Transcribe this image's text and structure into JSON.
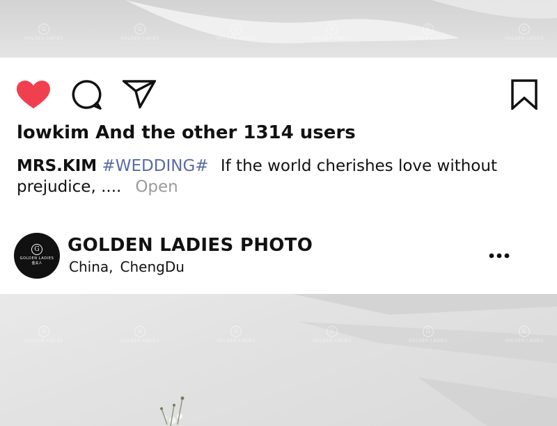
{
  "post_actions": {
    "like_icon": "heart-icon",
    "comment_icon": "comment-icon",
    "share_icon": "send-icon",
    "save_icon": "bookmark-icon",
    "like_color": "#f0404f"
  },
  "likes_text": "lowkim And the other 1314 users",
  "caption": {
    "author": "MRS.KIM",
    "hashtag": "#WEDDING#",
    "text_line1": "If the world cherishes love without",
    "text_line2": "prejudice, ....",
    "more": "Open"
  },
  "account": {
    "avatar": {
      "monogram": "G",
      "brand": "GOLDEN LADIES",
      "sub": "金夫人"
    },
    "name": "GOLDEN LADIES PHOTO",
    "location_country": "China",
    "location_separator": ",",
    "location_city": "ChengDu",
    "more_icon": "more-horizontal-icon"
  },
  "watermark": {
    "brand": "GOLDEN LADIES",
    "sub": "金夫人"
  }
}
